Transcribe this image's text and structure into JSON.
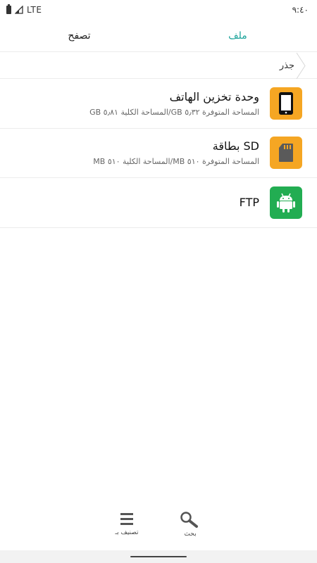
{
  "status": {
    "network": "LTE",
    "time": "٩:٤٠"
  },
  "tabs": {
    "file": "ملف",
    "browse": "تصفح",
    "active_color": "#1aa39a"
  },
  "breadcrumb": {
    "root": "جذر"
  },
  "storage": [
    {
      "title": "وحدة تخزين الهاتف",
      "subtitle": "المساحة المتوفرة ٥٫٣٢ GB/المساحة الكلية ٥٫٨١ GB",
      "icon": "phone-icon",
      "color": "#f5a623"
    },
    {
      "title": "بطاقة SD",
      "subtitle": "المساحة المتوفرة ٥١٠ MB/المساحة الكلية ٥١٠ MB",
      "icon": "sd-card-icon",
      "color": "#f5a623"
    },
    {
      "title": "FTP",
      "subtitle": "",
      "icon": "android-icon",
      "color": "#22ad52"
    }
  ],
  "toolbar": {
    "search_label": "بحث",
    "sort_label": "تصنيف بـ"
  }
}
